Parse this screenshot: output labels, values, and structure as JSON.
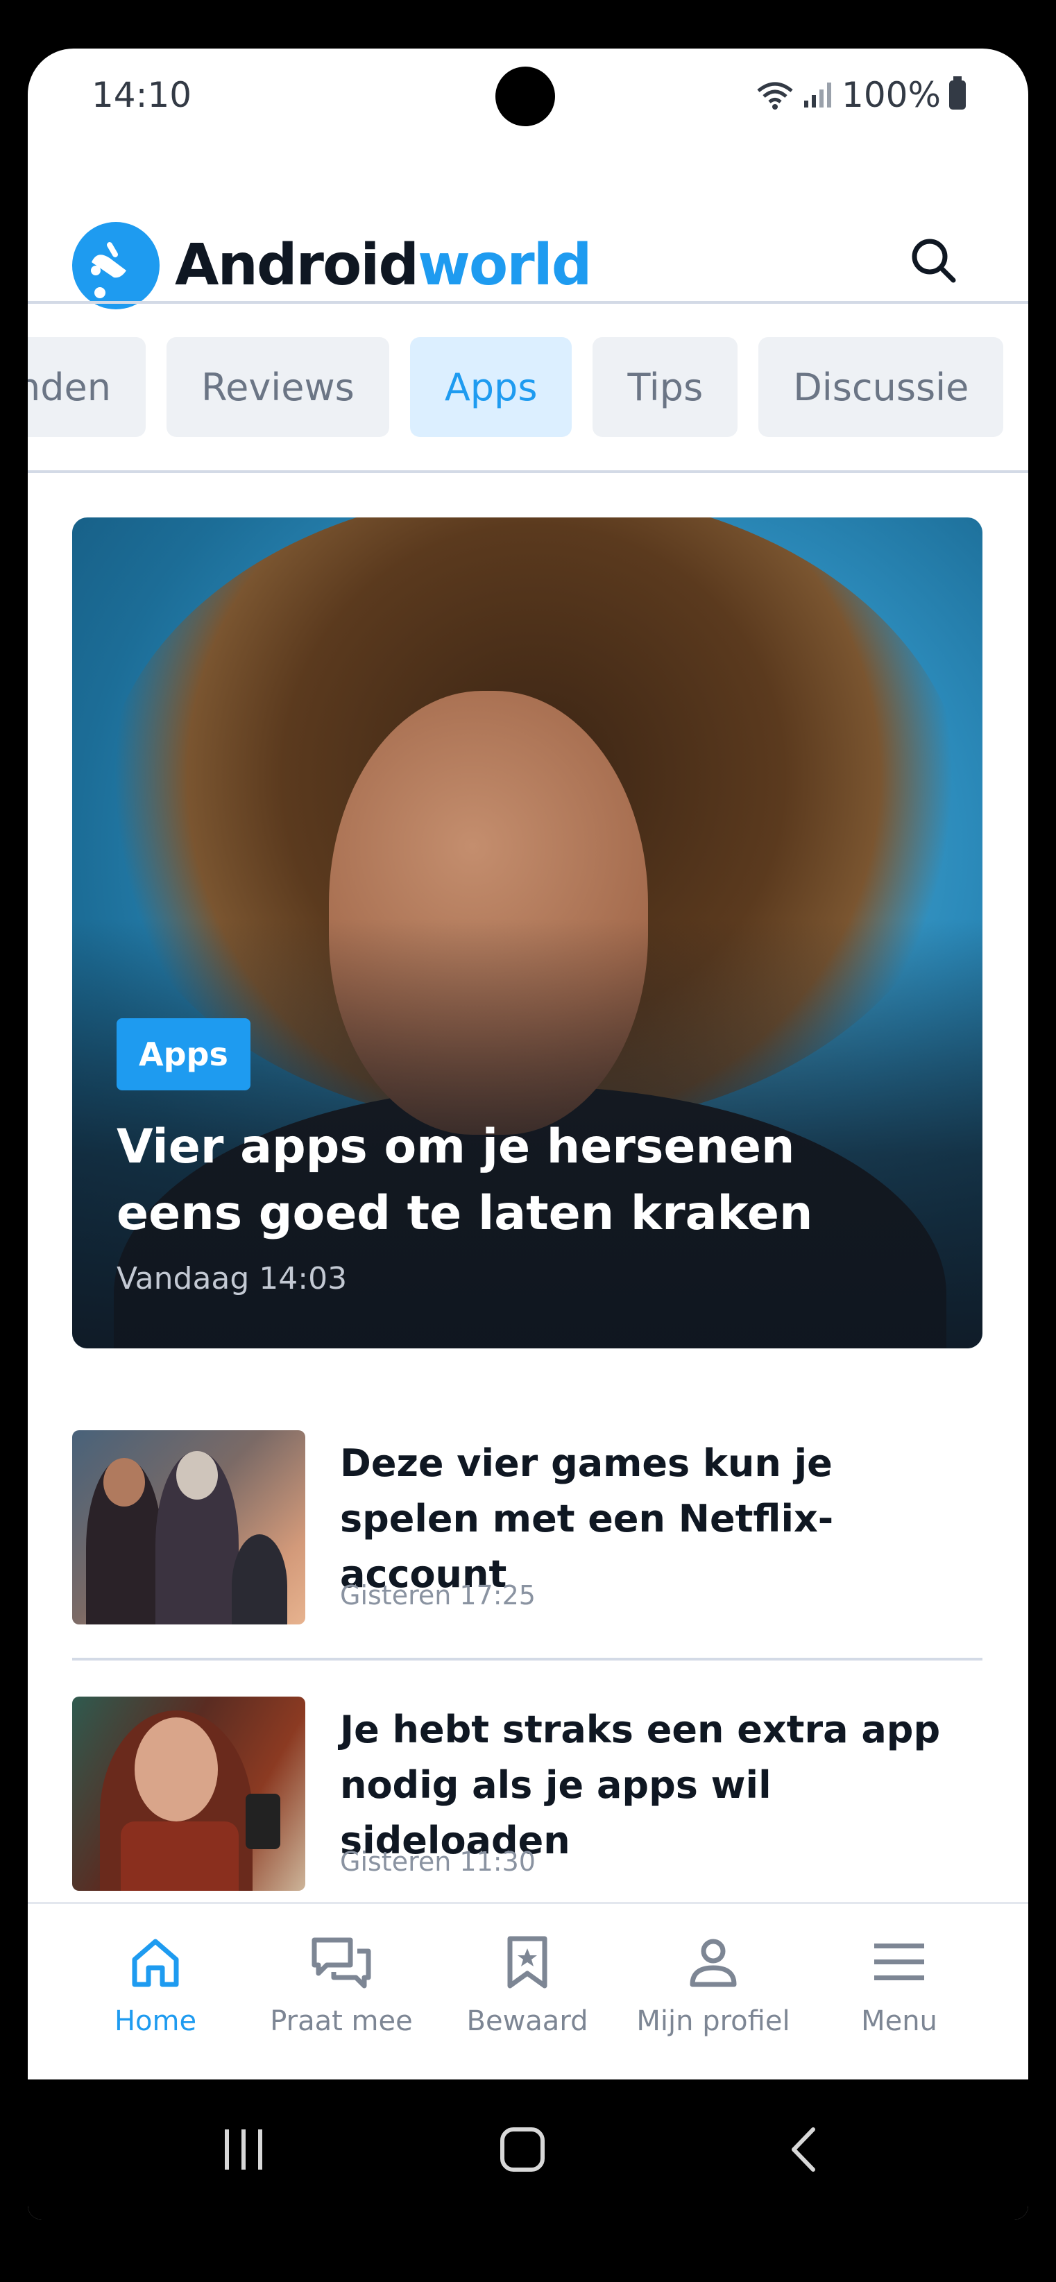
{
  "status_bar": {
    "time": "14:10",
    "battery": "100%"
  },
  "header": {
    "logo_text_primary": "Android",
    "logo_text_secondary": "world",
    "search_icon": "search-icon",
    "brand_color": "#1e9bf0"
  },
  "tabs": [
    {
      "label": "ronden",
      "active": false
    },
    {
      "label": "Reviews",
      "active": false
    },
    {
      "label": "Apps",
      "active": true
    },
    {
      "label": "Tips",
      "active": false
    },
    {
      "label": "Discussie",
      "active": false
    }
  ],
  "hero": {
    "category": "Apps",
    "title": "Vier apps om je hersenen eens goed te laten kraken",
    "date": "Vandaag 14:03"
  },
  "articles": [
    {
      "title": "Deze vier games kun je spelen met een Netflix-account",
      "date": "Gisteren 17:25"
    },
    {
      "title": "Je hebt straks een extra app nodig als je apps wil sideloaden",
      "date": "Gisteren 11:30"
    }
  ],
  "bottom_nav": [
    {
      "label": "Home",
      "icon": "home-icon",
      "active": true
    },
    {
      "label": "Praat mee",
      "icon": "chat-icon",
      "active": false
    },
    {
      "label": "Bewaard",
      "icon": "bookmark-icon",
      "active": false
    },
    {
      "label": "Mijn profiel",
      "icon": "profile-icon",
      "active": false
    },
    {
      "label": "Menu",
      "icon": "menu-icon",
      "active": false
    }
  ]
}
